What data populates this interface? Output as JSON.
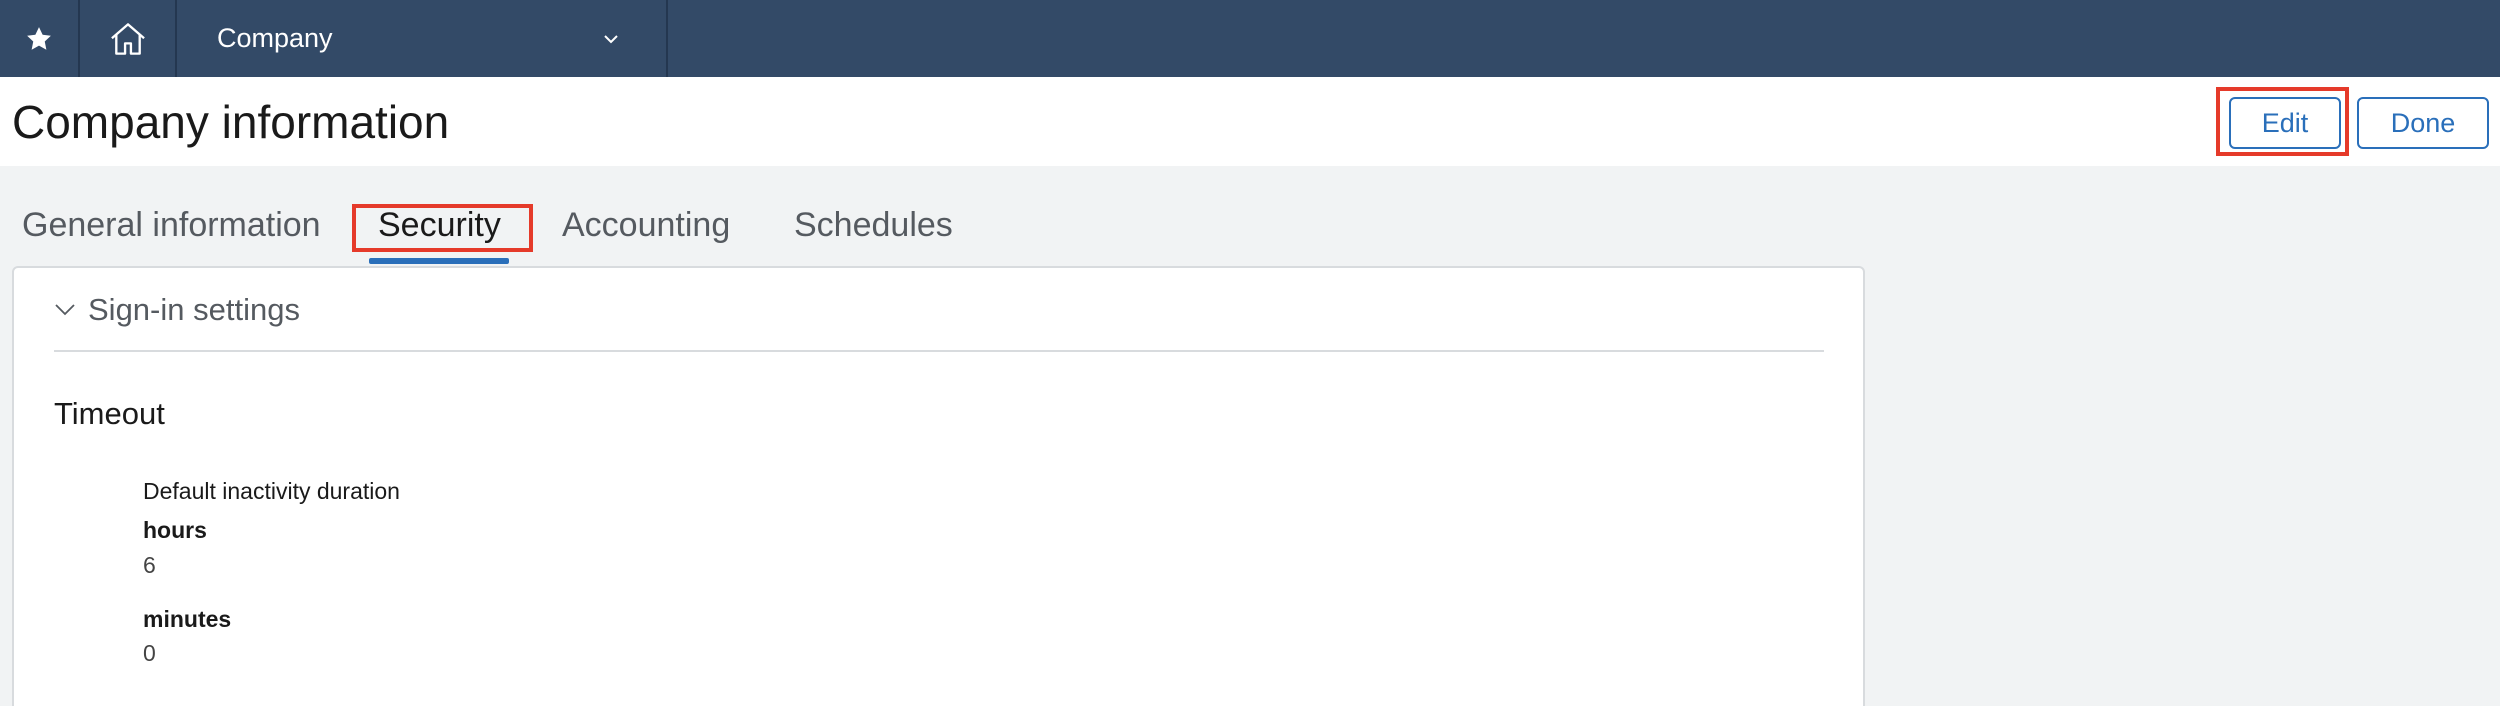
{
  "nav": {
    "star_icon": "star-icon",
    "home_icon": "home-icon",
    "module_label": "Company",
    "module_dropdown_icon": "chevron-down-icon",
    "bar_color": "#334a67"
  },
  "header": {
    "title": "Company information",
    "edit_label": "Edit",
    "done_label": "Done",
    "accent_color": "#2a6fba",
    "highlight_color": "#e53a2a"
  },
  "tabs": [
    {
      "label": "General information",
      "active": false
    },
    {
      "label": "Security",
      "active": true
    },
    {
      "label": "Accounting",
      "active": false
    },
    {
      "label": "Schedules",
      "active": false
    }
  ],
  "section": {
    "title": "Sign-in settings",
    "toggle_icon": "chevron-down-icon",
    "timeout": {
      "heading": "Timeout",
      "description": "Default inactivity duration",
      "hours_label": "hours",
      "hours_value": "6",
      "minutes_label": "minutes",
      "minutes_value": "0"
    }
  }
}
